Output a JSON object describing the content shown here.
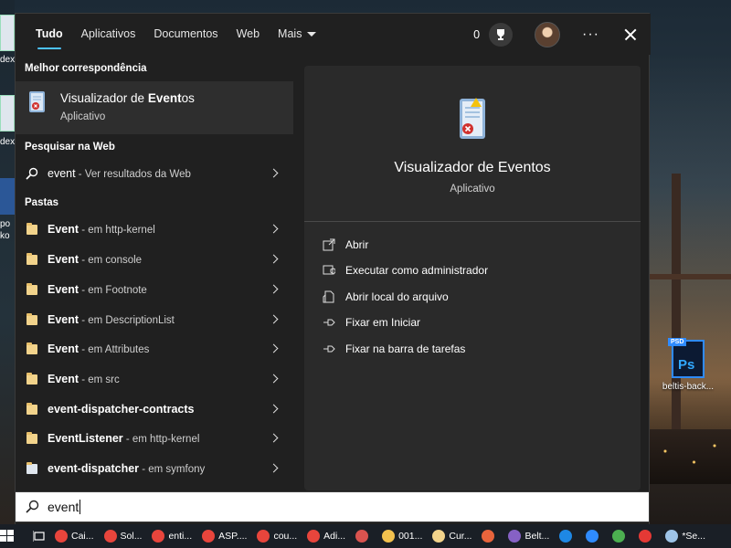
{
  "desktop": {
    "psd_label": "beltis-back...",
    "psd_badge": "PSD",
    "psd_text": "Ps",
    "left_labels": [
      "dex",
      "dex",
      "po",
      "ko"
    ]
  },
  "tabs": [
    {
      "label": "Tudo",
      "active": true
    },
    {
      "label": "Aplicativos",
      "active": false
    },
    {
      "label": "Documentos",
      "active": false
    },
    {
      "label": "Web",
      "active": false
    },
    {
      "label": "Mais",
      "active": false
    }
  ],
  "header": {
    "points": "0",
    "more_label": "···"
  },
  "sections": {
    "best_match": "Melhor correspondência",
    "web": "Pesquisar na Web",
    "folders": "Pastas"
  },
  "best_match": {
    "title_prefix": "Visualizador de ",
    "title_bold": "Event",
    "title_suffix": "os",
    "subtitle": "Aplicativo"
  },
  "web_result": {
    "main": "event",
    "sub": " - Ver resultados da Web"
  },
  "folders": [
    {
      "main": "Event",
      "sub": " - em http-kernel"
    },
    {
      "main": "Event",
      "sub": " - em console"
    },
    {
      "main": "Event",
      "sub": " - em Footnote"
    },
    {
      "main": "Event",
      "sub": " - em DescriptionList"
    },
    {
      "main": "Event",
      "sub": " - em Attributes"
    },
    {
      "main": "Event",
      "sub": " - em src"
    },
    {
      "main": "event-dispatcher-contracts",
      "sub": ""
    },
    {
      "main": "EventListener",
      "sub": " - em http-kernel"
    },
    {
      "main": "event-dispatcher",
      "sub": " - em symfony"
    }
  ],
  "preview": {
    "title": "Visualizador de Eventos",
    "subtitle": "Aplicativo",
    "actions": [
      {
        "label": "Abrir",
        "icon": "open-icon"
      },
      {
        "label": "Executar como administrador",
        "icon": "shield-icon"
      },
      {
        "label": "Abrir local do arquivo",
        "icon": "file-location-icon"
      },
      {
        "label": "Fixar em Iniciar",
        "icon": "pin-icon"
      },
      {
        "label": "Fixar na barra de tarefas",
        "icon": "pin-icon"
      }
    ]
  },
  "search": {
    "value": "event"
  },
  "taskbar": {
    "items": [
      {
        "label": "Cai...",
        "color": "#e8453c"
      },
      {
        "label": "Sol...",
        "color": "#e8453c"
      },
      {
        "label": "enti...",
        "color": "#e8453c"
      },
      {
        "label": "ASP....",
        "color": "#e8453c"
      },
      {
        "label": "cou...",
        "color": "#e8453c"
      },
      {
        "label": "Adi...",
        "color": "#e8453c"
      },
      {
        "label": "",
        "color": "#d9534f"
      },
      {
        "label": "001...",
        "color": "#f2c14e"
      },
      {
        "label": "Cur...",
        "color": "#f2d38b"
      },
      {
        "label": "",
        "color": "#e8643c"
      },
      {
        "label": "Belt...",
        "color": "#8661c5"
      },
      {
        "label": "",
        "color": "#1e88e5"
      },
      {
        "label": "",
        "color": "#2f8bff"
      },
      {
        "label": "",
        "color": "#4caf50"
      },
      {
        "label": "",
        "color": "#e53935"
      },
      {
        "label": "*Se...",
        "color": "#9ec4e8"
      }
    ]
  },
  "colors": {
    "accent": "#4cc2ff",
    "panel": "#202020",
    "preview": "#2a2a2a",
    "selected": "#2e2e2e"
  }
}
